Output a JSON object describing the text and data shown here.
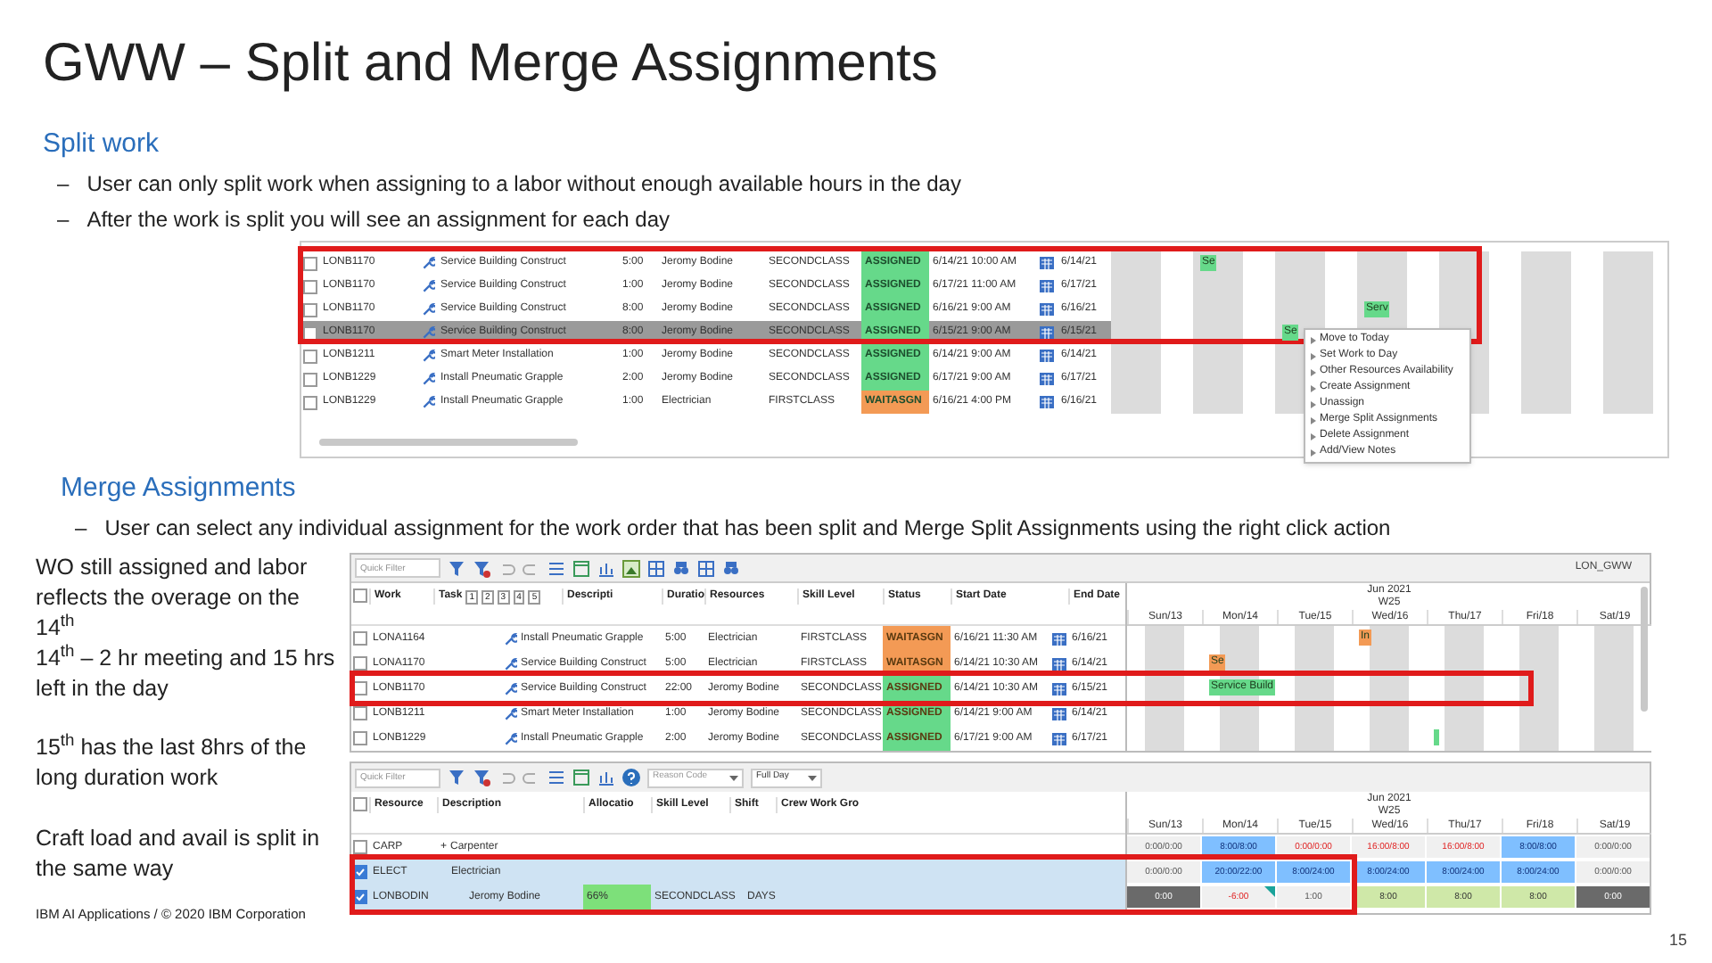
{
  "title": "GWW – Split and Merge Assignments",
  "split": {
    "heading": "Split work",
    "bullets": [
      "User can only split work when assigning to a labor without enough available hours in the day",
      "After the work is split you will see an assignment for each day"
    ],
    "dash": "–"
  },
  "screen1": {
    "rows": [
      {
        "work": "LONB1170",
        "task": "Service Building Construct",
        "duration": "5:00",
        "resource": "Jeromy Bodine",
        "skill": "SECONDCLASS",
        "status": "ASSIGNED",
        "color": "#66d98a",
        "start": "6/14/21 10:00 AM",
        "end": "6/14/21",
        "selected": false,
        "checked": false,
        "timeline": [
          {
            "bar": false
          },
          {
            "bar": true,
            "label": "Se"
          },
          {
            "bar": false
          },
          {
            "bar": false
          },
          {
            "bar": false
          },
          {
            "bar": false
          },
          {
            "bar": false
          }
        ]
      },
      {
        "work": "LONB1170",
        "task": "Service Building Construct",
        "duration": "1:00",
        "resource": "Jeromy Bodine",
        "skill": "SECONDCLASS",
        "status": "ASSIGNED",
        "color": "#66d98a",
        "start": "6/17/21 11:00 AM",
        "end": "6/17/21",
        "selected": false,
        "checked": false
      },
      {
        "work": "LONB1170",
        "task": "Service Building Construct",
        "duration": "8:00",
        "resource": "Jeromy Bodine",
        "skill": "SECONDCLASS",
        "status": "ASSIGNED",
        "color": "#66d98a",
        "start": "6/16/21 9:00 AM",
        "end": "6/16/21",
        "selected": false,
        "checked": false,
        "timeline": [
          {
            "bar": false
          },
          {
            "bar": false
          },
          {
            "bar": false
          },
          {
            "bar": true,
            "label": "Serv"
          },
          {
            "bar": false
          },
          {
            "bar": false
          },
          {
            "bar": false
          }
        ]
      },
      {
        "work": "LONB1170",
        "task": "Service Building Construct",
        "duration": "8:00",
        "resource": "Jeromy Bodine",
        "skill": "SECONDCLASS",
        "status": "ASSIGNED",
        "color": "#66d98a",
        "start": "6/15/21 9:00 AM",
        "end": "6/15/21",
        "selected": true,
        "checked": false,
        "timeline": [
          {
            "bar": false
          },
          {
            "bar": false
          },
          {
            "bar": true,
            "label": "Se"
          },
          {
            "bar": false
          },
          {
            "bar": false
          },
          {
            "bar": false
          },
          {
            "bar": false
          }
        ]
      },
      {
        "work": "LONB1211",
        "task": "Smart Meter Installation",
        "duration": "1:00",
        "resource": "Jeromy Bodine",
        "skill": "SECONDCLASS",
        "status": "ASSIGNED",
        "color": "#66d98a",
        "start": "6/14/21 9:00 AM",
        "end": "6/14/21",
        "selected": false,
        "checked": false
      },
      {
        "work": "LONB1229",
        "task": "Install Pneumatic Grapple",
        "duration": "2:00",
        "resource": "Jeromy Bodine",
        "skill": "SECONDCLASS",
        "status": "ASSIGNED",
        "color": "#66d98a",
        "start": "6/17/21 9:00 AM",
        "end": "6/17/21",
        "selected": false,
        "checked": false
      },
      {
        "work": "LONB1229",
        "task": "Install Pneumatic Grapple",
        "duration": "1:00",
        "resource": "Electrician",
        "skill": "FIRSTCLASS",
        "status": "WAITASGN",
        "color": "#f39a55",
        "start": "6/16/21 4:00 PM",
        "end": "6/16/21",
        "selected": false,
        "checked": false
      }
    ],
    "menu": [
      "Move to Today",
      "Set Work to Day",
      "Other Resources Availability",
      "Create Assignment",
      "Unassign",
      "Merge Split Assignments",
      "Delete Assignment",
      "Add/View Notes"
    ]
  },
  "merge": {
    "heading": "Merge Assignments",
    "bullet": "User can select any individual assignment for the work order that has been split and Merge Split Assignments using the right click action",
    "dash": "–"
  },
  "notes": [
    "WO still assigned and labor reflects the overage on the 14$^{th}$",
    "14$^{th}$ – 2 hr meeting and 15 hrs left in the day",
    "15$^{th}$ has the last 8hrs of the long duration work",
    "Craft load and avail is split in the same way"
  ],
  "screen2": {
    "filter_placeholder": "Quick Filter",
    "user": "LON_GWW",
    "select_all_checked": false,
    "columns": [
      "Work",
      "Task",
      "Descripti",
      "Duratio",
      "Resources",
      "Skill Level",
      "Status",
      "Start Date",
      "End Date"
    ],
    "task_levels": [
      "1",
      "2",
      "3",
      "4",
      "5"
    ],
    "month": "Jun 2021",
    "week": "W25",
    "days": [
      "Sun/13",
      "Mon/14",
      "Tue/15",
      "Wed/16",
      "Thu/17",
      "Fri/18",
      "Sat/19"
    ],
    "rows": [
      {
        "work": "LONA1164",
        "task": "Install Pneumatic Grapple",
        "duration": "5:00",
        "resource": "Electrician",
        "skill": "FIRSTCLASS",
        "status": "WAITASGN",
        "color": "#f39a55",
        "start": "6/16/21 11:30 AM",
        "end": "6/16/21",
        "checked": false,
        "timeline": [
          {
            "bar": false
          },
          {
            "bar": false
          },
          {
            "bar": false
          },
          {
            "bar": true,
            "label": "In",
            "color": "#f39a55"
          },
          {
            "bar": false
          },
          {
            "bar": false
          },
          {
            "bar": false
          }
        ]
      },
      {
        "work": "LONA1170",
        "task": "Service Building Construct",
        "duration": "5:00",
        "resource": "Electrician",
        "skill": "FIRSTCLASS",
        "status": "WAITASGN",
        "color": "#f39a55",
        "start": "6/14/21 10:30 AM",
        "end": "6/14/21",
        "checked": false,
        "timeline": [
          {
            "bar": false
          },
          {
            "bar": true,
            "label": "Se",
            "color": "#f39a55"
          },
          {
            "bar": false
          },
          {
            "bar": false
          },
          {
            "bar": false
          },
          {
            "bar": false
          },
          {
            "bar": false
          }
        ]
      },
      {
        "work": "LONB1170",
        "task": "Service Building Construct",
        "duration": "22:00",
        "resource": "Jeromy Bodine",
        "skill": "SECONDCLASS",
        "status": "ASSIGNED",
        "color": "#66d98a",
        "start": "6/14/21 10:30 AM",
        "end": "6/15/21",
        "checked": false,
        "timeline": [
          {
            "bar": false
          },
          {
            "bar": true,
            "label": "Service Build",
            "color": "#66d98a"
          },
          {
            "bar": false
          },
          {
            "bar": false
          },
          {
            "bar": false
          },
          {
            "bar": false
          },
          {
            "bar": false
          }
        ]
      },
      {
        "work": "LONB1211",
        "task": "Smart Meter Installation",
        "duration": "1:00",
        "resource": "Jeromy Bodine",
        "skill": "SECONDCLASS",
        "status": "ASSIGNED",
        "color": "#66d98a",
        "start": "6/14/21 9:00 AM",
        "end": "6/14/21",
        "checked": false
      },
      {
        "work": "LONB1229",
        "task": "Install Pneumatic Grapple",
        "duration": "2:00",
        "resource": "Jeromy Bodine",
        "skill": "SECONDCLASS",
        "status": "ASSIGNED",
        "color": "#66d98a",
        "start": "6/17/21 9:00 AM",
        "end": "6/17/21",
        "checked": false,
        "timeline": [
          {
            "bar": false
          },
          {
            "bar": false
          },
          {
            "bar": false
          },
          {
            "bar": false
          },
          {
            "bar": true,
            "color": "#66d98a"
          },
          {
            "bar": false
          },
          {
            "bar": false
          }
        ]
      }
    ]
  },
  "screen3": {
    "filter_placeholder": "Quick Filter",
    "reason_placeholder": "Reason Code",
    "period": "Full Day",
    "select_all_checked": false,
    "columns": [
      "Resource",
      "Description",
      "Allocatio",
      "Skill Level",
      "Shift",
      "Crew Work Gro"
    ],
    "month": "Jun 2021",
    "week": "W25",
    "days": [
      "Sun/13",
      "Mon/14",
      "Tue/15",
      "Wed/16",
      "Thu/17",
      "Fri/18",
      "Sat/19"
    ],
    "rows": [
      {
        "resource": "CARP",
        "description": "Carpenter",
        "expander": "+",
        "checked": false,
        "cells": [
          {
            "text": "0:00/0:00",
            "kind": "plain"
          },
          {
            "text": "8:00/8:00",
            "kind": "booked"
          },
          {
            "text": "0:00/0:00",
            "kind": "over"
          },
          {
            "text": "16:00/8:00",
            "kind": "over"
          },
          {
            "text": "16:00/8:00",
            "kind": "over"
          },
          {
            "text": "8:00/8:00",
            "kind": "booked"
          },
          {
            "text": "0:00/0:00",
            "kind": "plain"
          }
        ]
      },
      {
        "resource": "ELECT",
        "description": "Electrician",
        "checked": true,
        "cells": [
          {
            "text": "0:00/0:00",
            "kind": "plain"
          },
          {
            "text": "20:00/22:00",
            "kind": "booked"
          },
          {
            "text": "8:00/24:00",
            "kind": "booked"
          },
          {
            "text": "8:00/24:00",
            "kind": "booked"
          },
          {
            "text": "8:00/24:00",
            "kind": "booked"
          },
          {
            "text": "8:00/24:00",
            "kind": "booked"
          },
          {
            "text": "0:00/0:00",
            "kind": "plain"
          }
        ]
      },
      {
        "resource": "LONBODIN",
        "description": "Jeromy Bodine",
        "allocation": "66%",
        "skill": "SECONDCLASS",
        "shift": "DAYS",
        "checked": true,
        "cells": [
          {
            "text": "0:00",
            "kind": "dark"
          },
          {
            "text": "-6:00",
            "kind": "flag"
          },
          {
            "text": "1:00",
            "kind": "plain"
          },
          {
            "text": "8:00",
            "kind": "ok"
          },
          {
            "text": "8:00",
            "kind": "ok"
          },
          {
            "text": "8:00",
            "kind": "ok"
          },
          {
            "text": "0:00",
            "kind": "dark"
          }
        ]
      }
    ]
  },
  "footer": "IBM AI Applications / © 2020 IBM Corporation",
  "page": "15"
}
